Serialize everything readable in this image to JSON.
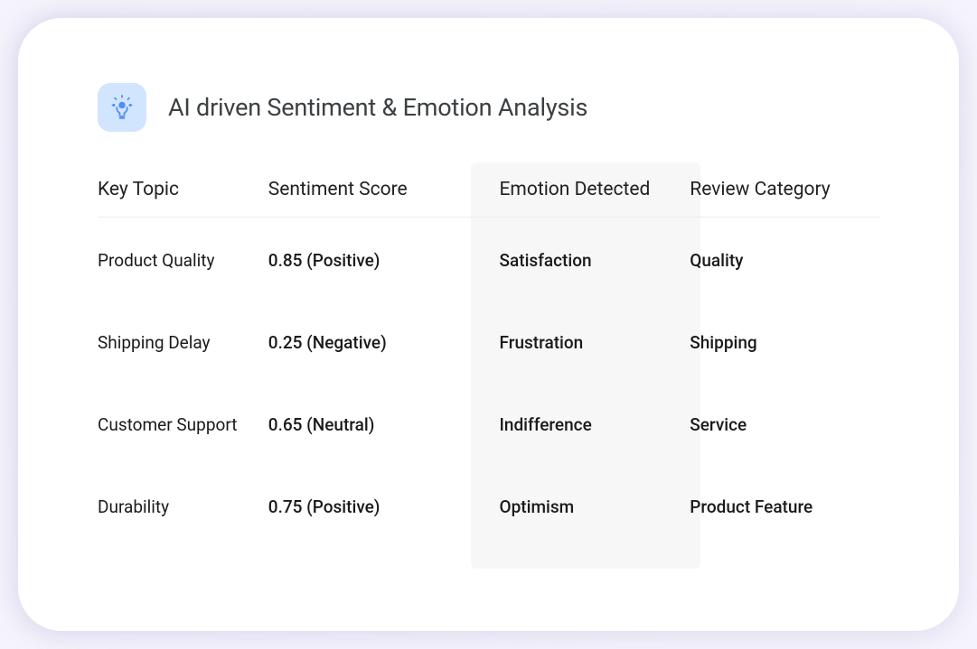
{
  "header": {
    "title": "AI driven Sentiment & Emotion Analysis"
  },
  "table": {
    "columns": {
      "topic": "Key Topic",
      "score": "Sentiment Score",
      "emotion": "Emotion Detected",
      "category": "Review Category"
    },
    "rows": [
      {
        "topic": "Product Quality",
        "score": "0.85 (Positive)",
        "emotion": "Satisfaction",
        "category": "Quality"
      },
      {
        "topic": "Shipping Delay",
        "score": "0.25 (Negative)",
        "emotion": "Frustration",
        "category": "Shipping"
      },
      {
        "topic": "Customer Support",
        "score": "0.65 (Neutral)",
        "emotion": "Indifference",
        "category": "Service"
      },
      {
        "topic": "Durability",
        "score": "0.75 (Positive)",
        "emotion": "Optimism",
        "category": "Product Feature"
      }
    ]
  }
}
